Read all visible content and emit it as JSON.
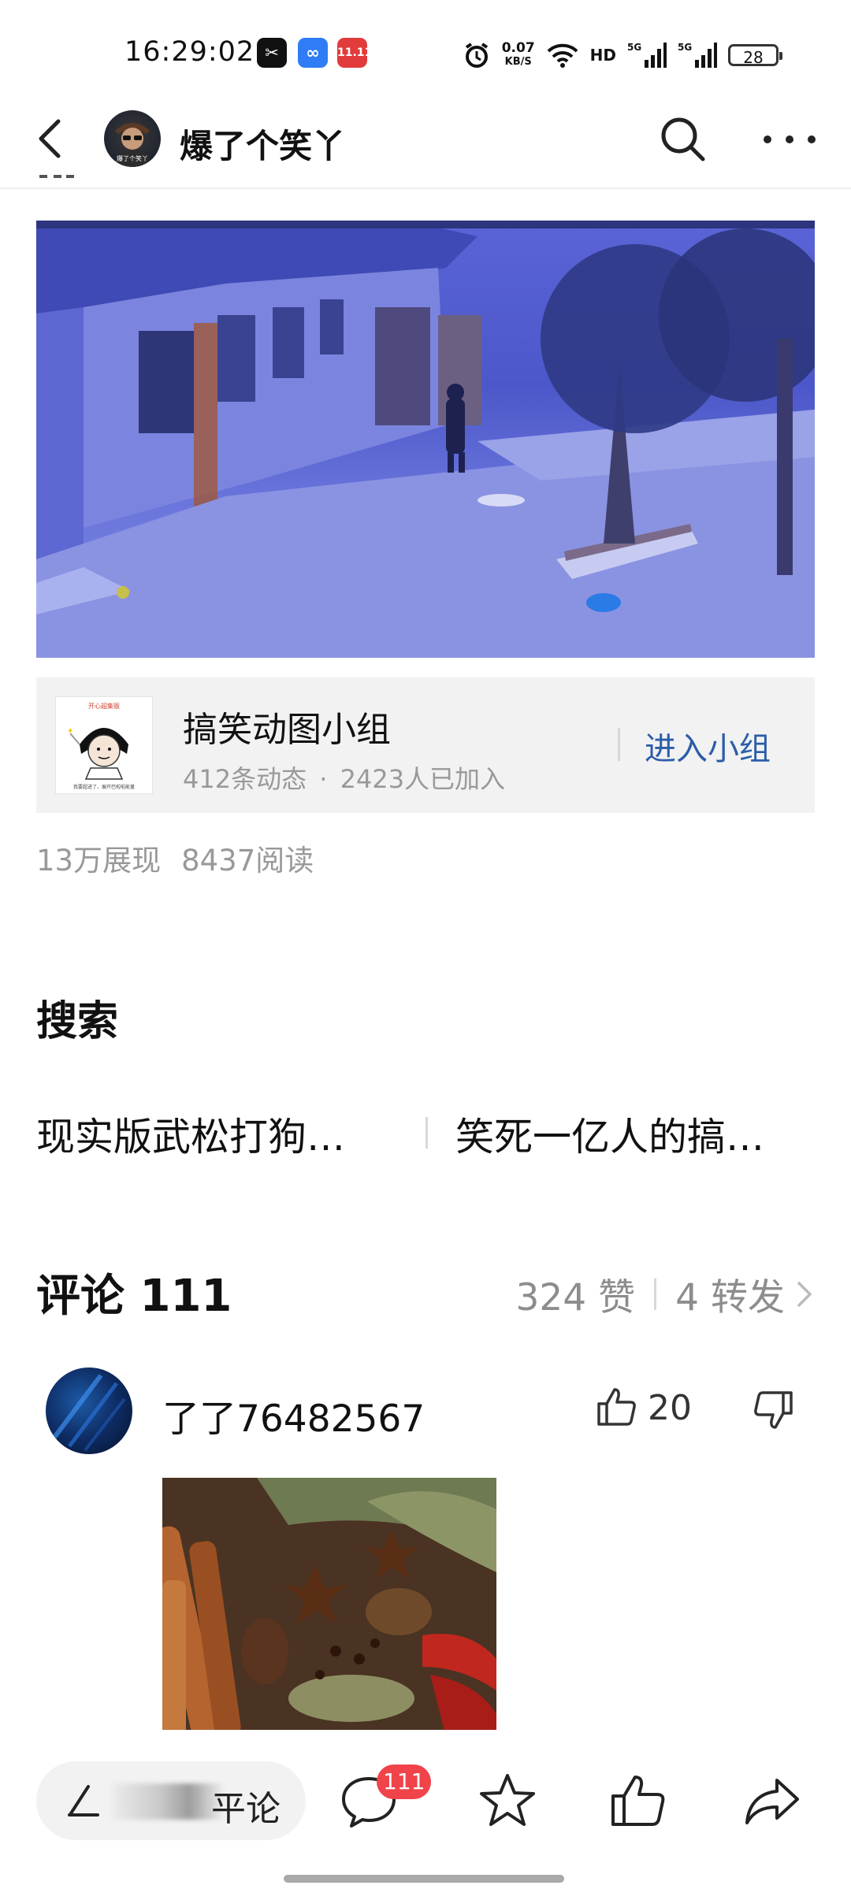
{
  "status_bar": {
    "time": "16:29:02",
    "speed_value": "0.07",
    "speed_unit": "KB/S",
    "hd_label": "HD",
    "signal_labels": [
      "5G",
      "5G"
    ],
    "battery": "28",
    "app_icons": [
      {
        "name": "capcut-icon",
        "color": "#111111"
      },
      {
        "name": "infinity-app-icon",
        "color": "#2f7cf6"
      },
      {
        "name": "shopping-11-11-icon",
        "color": "#e23b3b"
      }
    ]
  },
  "nav": {
    "title": "爆了个笑丫",
    "avatar_caption": "爆了个笑丫"
  },
  "group": {
    "name": "搞笑动图小组",
    "posts": "412条动态",
    "separator": "·",
    "members": "2423人已加入",
    "join_label": "进入小组",
    "thumb_caption_top": "开心超集贩",
    "thumb_caption_bottom": "我要超进了，展开巴啦啦能量"
  },
  "stats": {
    "impressions": "13万展现",
    "reads": "8437阅读"
  },
  "search": {
    "heading": "搜索",
    "items": [
      "现实版武松打狗…",
      "笑死一亿人的搞…"
    ]
  },
  "comments": {
    "title": "评论 111",
    "likes": "324 赞",
    "shares": "4 转发"
  },
  "comment": {
    "username": "了了76482567",
    "likes": "20"
  },
  "bottom_bar": {
    "input_tail": "平论",
    "comment_badge": "111"
  },
  "colors": {
    "accent_link": "#2b5da8",
    "badge_red": "#f0434a",
    "video_tint": "#5a64d6"
  }
}
